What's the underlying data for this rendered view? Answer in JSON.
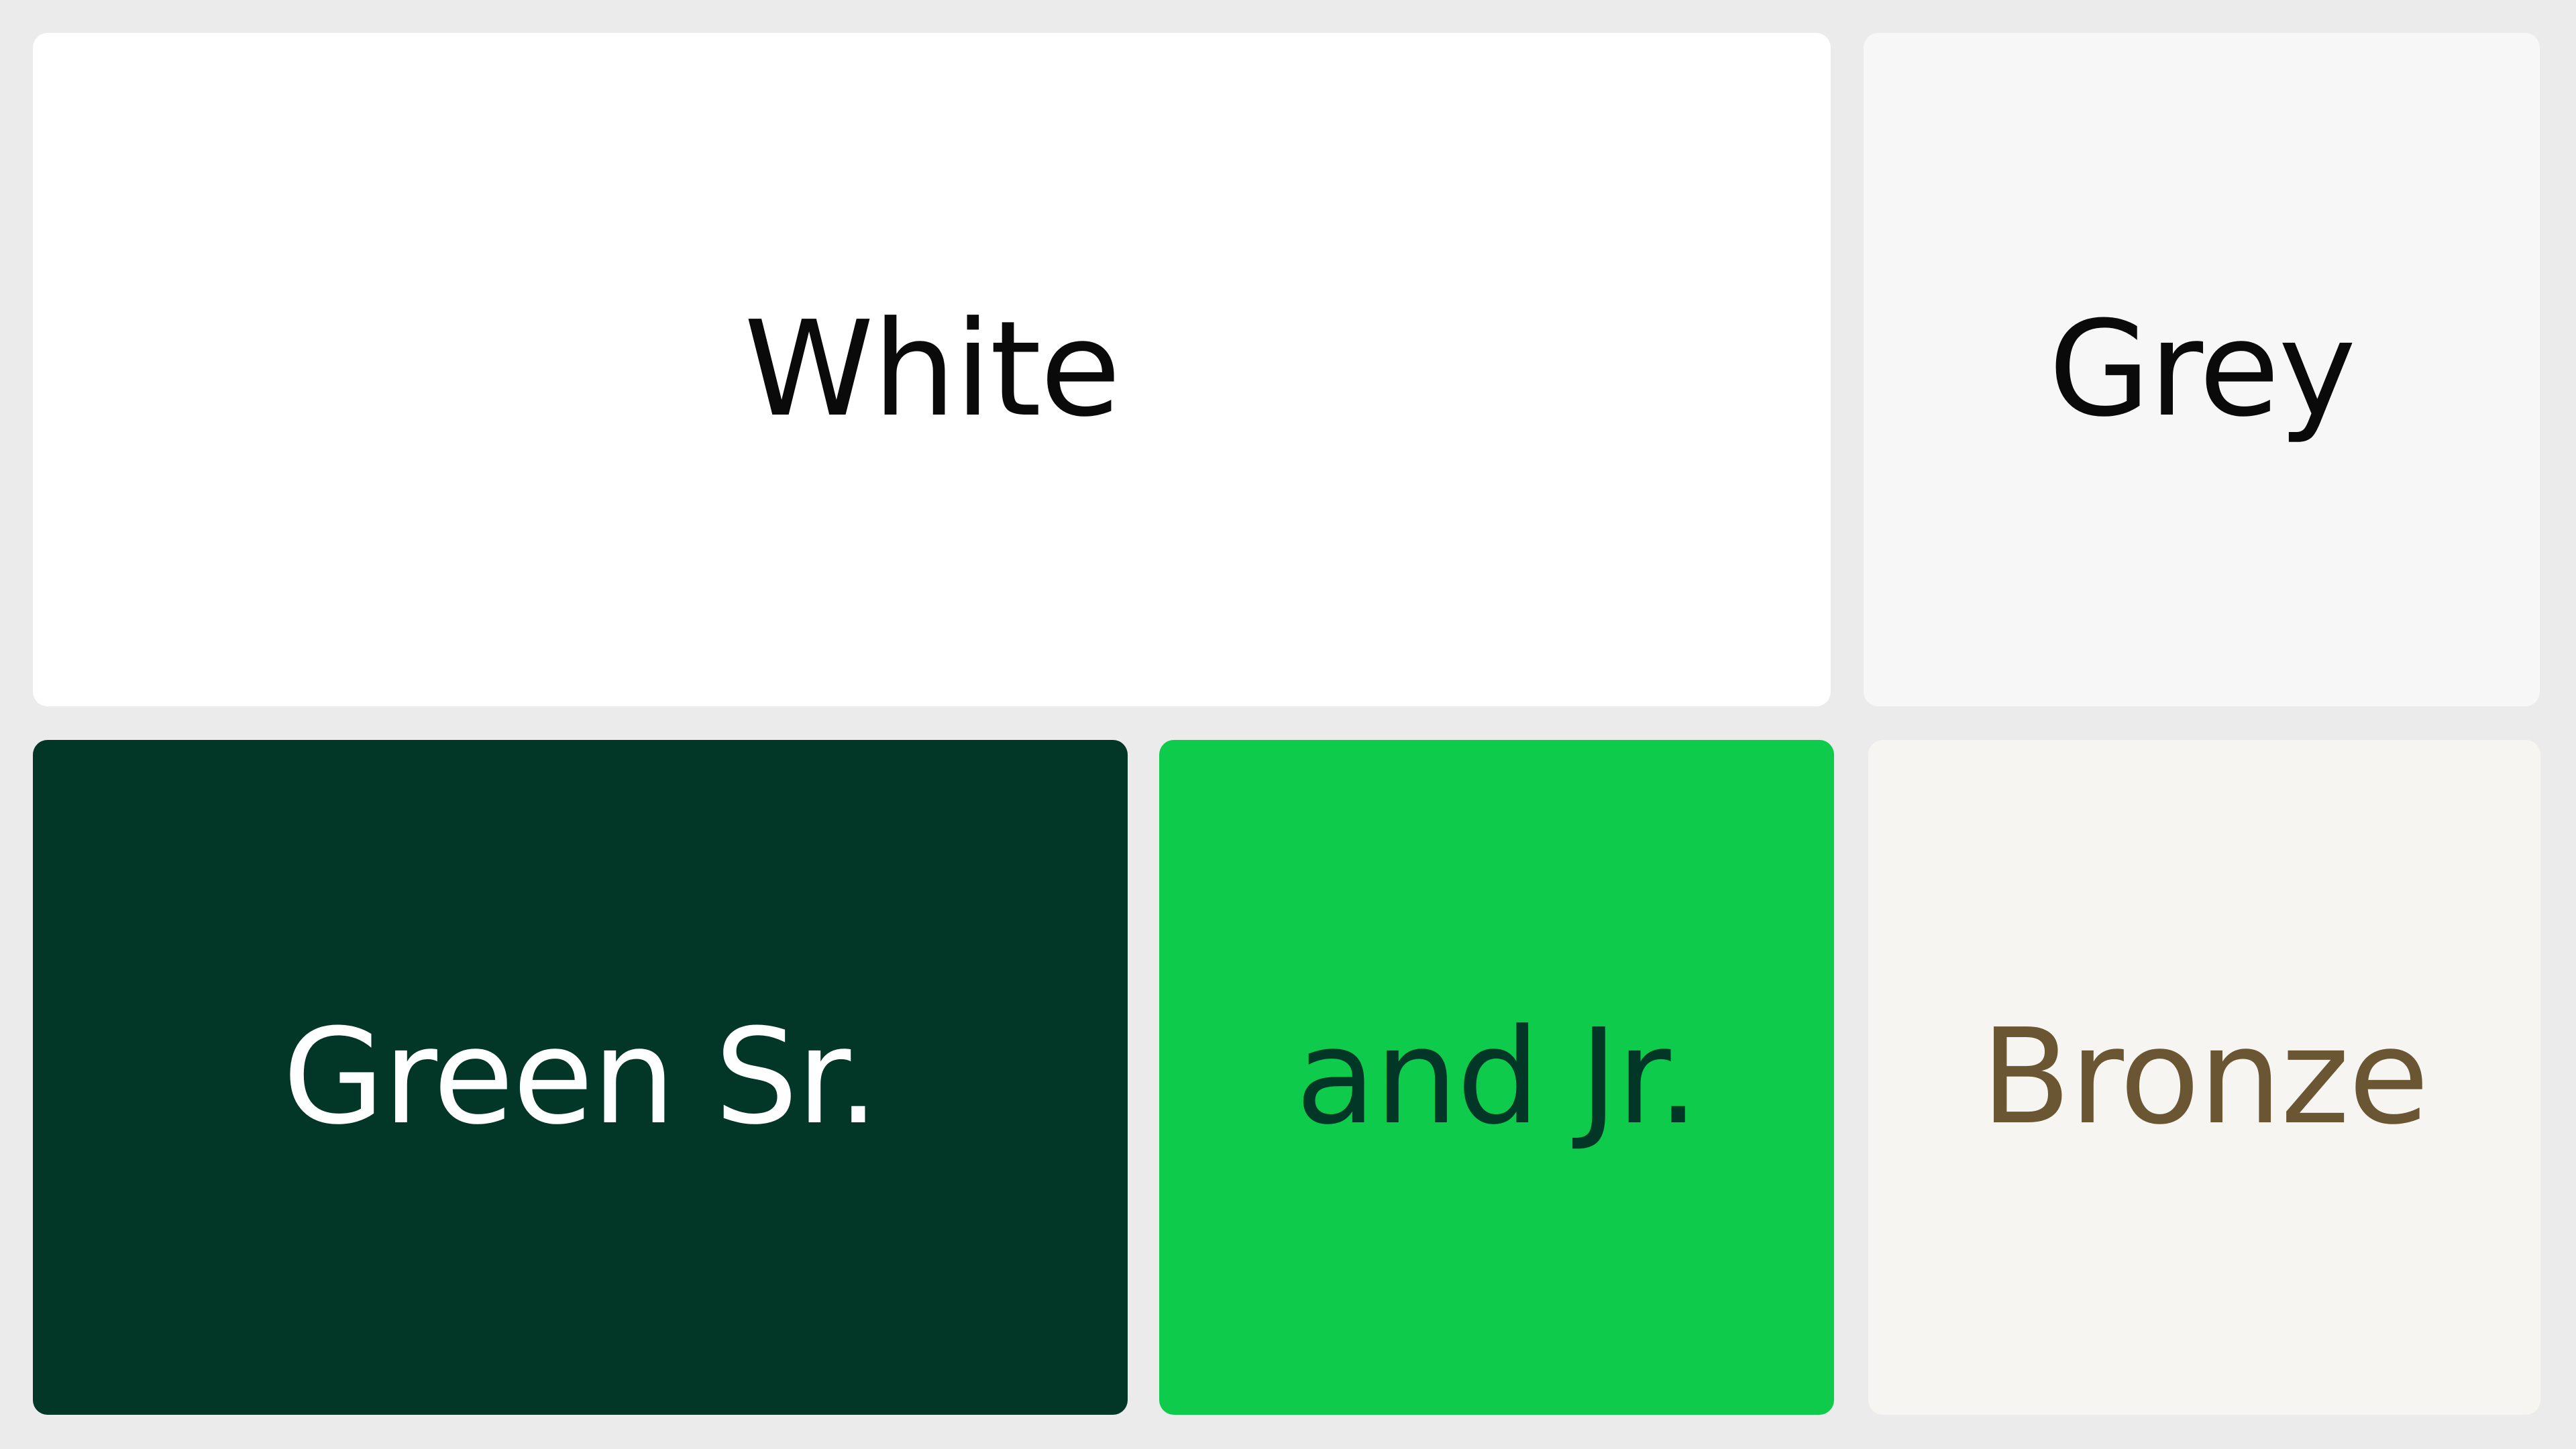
{
  "swatches": [
    {
      "id": "white",
      "label": "White",
      "background": "#ffffff",
      "text_color": "#0a0a0a"
    },
    {
      "id": "grey",
      "label": "Grey",
      "background": "#f7f7f7",
      "text_color": "#0a0a0a"
    },
    {
      "id": "green",
      "label": "Green Sr.",
      "background": "#023626",
      "text_color": "#ffffff"
    },
    {
      "id": "jr",
      "label": "and Jr.",
      "background": "#0ecb4b",
      "text_color": "#023626"
    },
    {
      "id": "bronze",
      "label": "Bronze",
      "background": "#f6f5f1",
      "text_color": "#6b5633"
    }
  ],
  "page_background": "#ebebeb"
}
